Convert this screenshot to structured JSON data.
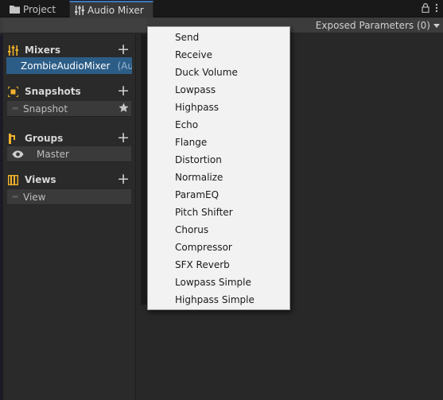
{
  "tabs": {
    "project": "Project",
    "audio_mixer": "Audio Mixer"
  },
  "tab_icons": {
    "project": "folder-icon",
    "audio_mixer": "mixer-sliders-icon",
    "lock": "lock-icon",
    "menu": "kebab-menu-icon"
  },
  "toolbar": {
    "exposed_parameters": "Exposed Parameters (0)"
  },
  "sidebar": {
    "mixers": {
      "title": "Mixers",
      "items": [
        {
          "label": "ZombieAudioMixer",
          "suffix": "(Aud"
        }
      ]
    },
    "snapshots": {
      "title": "Snapshots",
      "items": [
        {
          "label": "Snapshot"
        }
      ]
    },
    "groups": {
      "title": "Groups",
      "items": [
        {
          "label": "Master"
        }
      ]
    },
    "views": {
      "title": "Views",
      "items": [
        {
          "label": "View"
        }
      ]
    },
    "add_symbol": "+"
  },
  "effects_menu": {
    "items": [
      "Send",
      "Receive",
      "Duck Volume",
      "Lowpass",
      "Highpass",
      "Echo",
      "Flange",
      "Distortion",
      "Normalize",
      "ParamEQ",
      "Pitch Shifter",
      "Chorus",
      "Compressor",
      "SFX Reverb",
      "Lowpass Simple",
      "Highpass Simple"
    ]
  },
  "colors": {
    "accent": "#f0b32c",
    "selection": "#2c5d87",
    "tab_highlight": "#3a79bb"
  }
}
